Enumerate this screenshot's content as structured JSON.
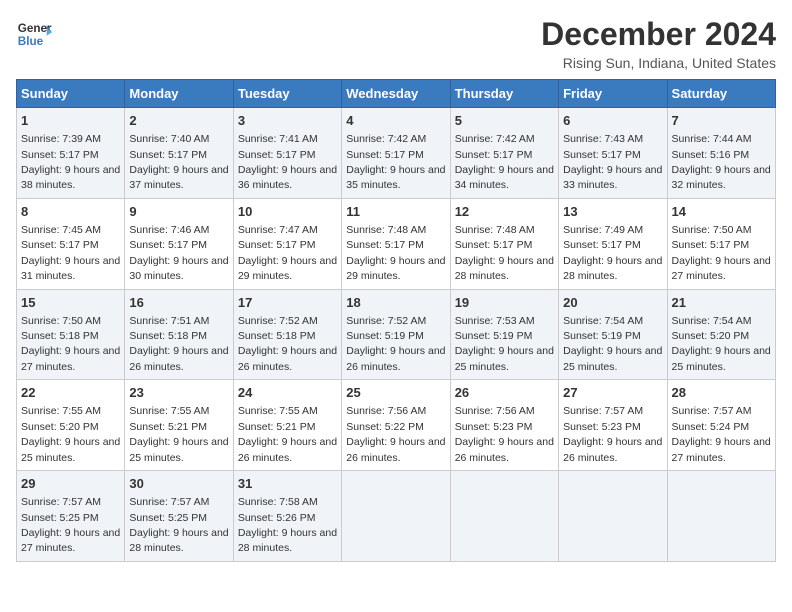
{
  "header": {
    "logo_line1": "General",
    "logo_line2": "Blue",
    "title": "December 2024",
    "subtitle": "Rising Sun, Indiana, United States"
  },
  "columns": [
    "Sunday",
    "Monday",
    "Tuesday",
    "Wednesday",
    "Thursday",
    "Friday",
    "Saturday"
  ],
  "weeks": [
    [
      {
        "day": "1",
        "sunrise": "Sunrise: 7:39 AM",
        "sunset": "Sunset: 5:17 PM",
        "daylight": "Daylight: 9 hours and 38 minutes."
      },
      {
        "day": "2",
        "sunrise": "Sunrise: 7:40 AM",
        "sunset": "Sunset: 5:17 PM",
        "daylight": "Daylight: 9 hours and 37 minutes."
      },
      {
        "day": "3",
        "sunrise": "Sunrise: 7:41 AM",
        "sunset": "Sunset: 5:17 PM",
        "daylight": "Daylight: 9 hours and 36 minutes."
      },
      {
        "day": "4",
        "sunrise": "Sunrise: 7:42 AM",
        "sunset": "Sunset: 5:17 PM",
        "daylight": "Daylight: 9 hours and 35 minutes."
      },
      {
        "day": "5",
        "sunrise": "Sunrise: 7:42 AM",
        "sunset": "Sunset: 5:17 PM",
        "daylight": "Daylight: 9 hours and 34 minutes."
      },
      {
        "day": "6",
        "sunrise": "Sunrise: 7:43 AM",
        "sunset": "Sunset: 5:17 PM",
        "daylight": "Daylight: 9 hours and 33 minutes."
      },
      {
        "day": "7",
        "sunrise": "Sunrise: 7:44 AM",
        "sunset": "Sunset: 5:16 PM",
        "daylight": "Daylight: 9 hours and 32 minutes."
      }
    ],
    [
      {
        "day": "8",
        "sunrise": "Sunrise: 7:45 AM",
        "sunset": "Sunset: 5:17 PM",
        "daylight": "Daylight: 9 hours and 31 minutes."
      },
      {
        "day": "9",
        "sunrise": "Sunrise: 7:46 AM",
        "sunset": "Sunset: 5:17 PM",
        "daylight": "Daylight: 9 hours and 30 minutes."
      },
      {
        "day": "10",
        "sunrise": "Sunrise: 7:47 AM",
        "sunset": "Sunset: 5:17 PM",
        "daylight": "Daylight: 9 hours and 29 minutes."
      },
      {
        "day": "11",
        "sunrise": "Sunrise: 7:48 AM",
        "sunset": "Sunset: 5:17 PM",
        "daylight": "Daylight: 9 hours and 29 minutes."
      },
      {
        "day": "12",
        "sunrise": "Sunrise: 7:48 AM",
        "sunset": "Sunset: 5:17 PM",
        "daylight": "Daylight: 9 hours and 28 minutes."
      },
      {
        "day": "13",
        "sunrise": "Sunrise: 7:49 AM",
        "sunset": "Sunset: 5:17 PM",
        "daylight": "Daylight: 9 hours and 28 minutes."
      },
      {
        "day": "14",
        "sunrise": "Sunrise: 7:50 AM",
        "sunset": "Sunset: 5:17 PM",
        "daylight": "Daylight: 9 hours and 27 minutes."
      }
    ],
    [
      {
        "day": "15",
        "sunrise": "Sunrise: 7:50 AM",
        "sunset": "Sunset: 5:18 PM",
        "daylight": "Daylight: 9 hours and 27 minutes."
      },
      {
        "day": "16",
        "sunrise": "Sunrise: 7:51 AM",
        "sunset": "Sunset: 5:18 PM",
        "daylight": "Daylight: 9 hours and 26 minutes."
      },
      {
        "day": "17",
        "sunrise": "Sunrise: 7:52 AM",
        "sunset": "Sunset: 5:18 PM",
        "daylight": "Daylight: 9 hours and 26 minutes."
      },
      {
        "day": "18",
        "sunrise": "Sunrise: 7:52 AM",
        "sunset": "Sunset: 5:19 PM",
        "daylight": "Daylight: 9 hours and 26 minutes."
      },
      {
        "day": "19",
        "sunrise": "Sunrise: 7:53 AM",
        "sunset": "Sunset: 5:19 PM",
        "daylight": "Daylight: 9 hours and 25 minutes."
      },
      {
        "day": "20",
        "sunrise": "Sunrise: 7:54 AM",
        "sunset": "Sunset: 5:19 PM",
        "daylight": "Daylight: 9 hours and 25 minutes."
      },
      {
        "day": "21",
        "sunrise": "Sunrise: 7:54 AM",
        "sunset": "Sunset: 5:20 PM",
        "daylight": "Daylight: 9 hours and 25 minutes."
      }
    ],
    [
      {
        "day": "22",
        "sunrise": "Sunrise: 7:55 AM",
        "sunset": "Sunset: 5:20 PM",
        "daylight": "Daylight: 9 hours and 25 minutes."
      },
      {
        "day": "23",
        "sunrise": "Sunrise: 7:55 AM",
        "sunset": "Sunset: 5:21 PM",
        "daylight": "Daylight: 9 hours and 25 minutes."
      },
      {
        "day": "24",
        "sunrise": "Sunrise: 7:55 AM",
        "sunset": "Sunset: 5:21 PM",
        "daylight": "Daylight: 9 hours and 26 minutes."
      },
      {
        "day": "25",
        "sunrise": "Sunrise: 7:56 AM",
        "sunset": "Sunset: 5:22 PM",
        "daylight": "Daylight: 9 hours and 26 minutes."
      },
      {
        "day": "26",
        "sunrise": "Sunrise: 7:56 AM",
        "sunset": "Sunset: 5:23 PM",
        "daylight": "Daylight: 9 hours and 26 minutes."
      },
      {
        "day": "27",
        "sunrise": "Sunrise: 7:57 AM",
        "sunset": "Sunset: 5:23 PM",
        "daylight": "Daylight: 9 hours and 26 minutes."
      },
      {
        "day": "28",
        "sunrise": "Sunrise: 7:57 AM",
        "sunset": "Sunset: 5:24 PM",
        "daylight": "Daylight: 9 hours and 27 minutes."
      }
    ],
    [
      {
        "day": "29",
        "sunrise": "Sunrise: 7:57 AM",
        "sunset": "Sunset: 5:25 PM",
        "daylight": "Daylight: 9 hours and 27 minutes."
      },
      {
        "day": "30",
        "sunrise": "Sunrise: 7:57 AM",
        "sunset": "Sunset: 5:25 PM",
        "daylight": "Daylight: 9 hours and 28 minutes."
      },
      {
        "day": "31",
        "sunrise": "Sunrise: 7:58 AM",
        "sunset": "Sunset: 5:26 PM",
        "daylight": "Daylight: 9 hours and 28 minutes."
      },
      null,
      null,
      null,
      null
    ]
  ]
}
